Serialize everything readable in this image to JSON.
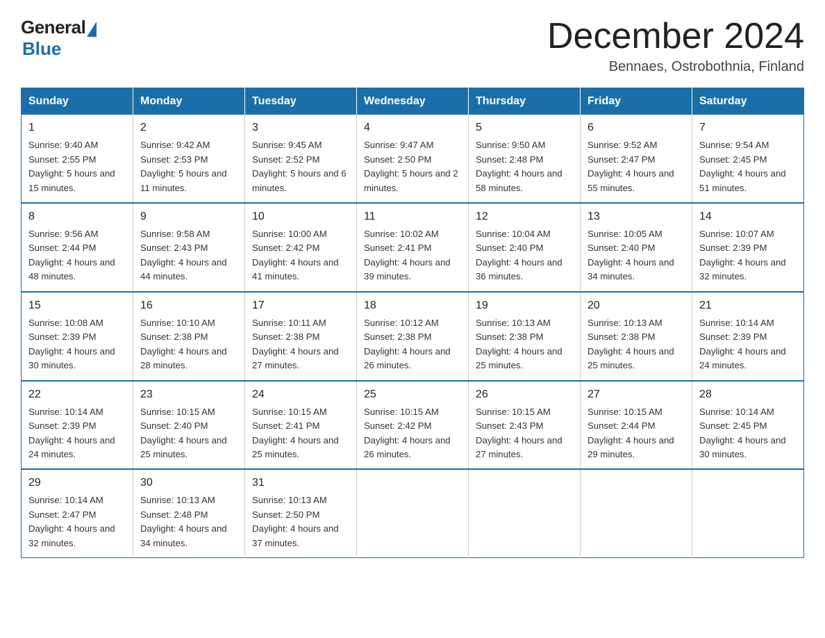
{
  "logo": {
    "general": "General",
    "blue": "Blue"
  },
  "title": "December 2024",
  "subtitle": "Bennaes, Ostrobothnia, Finland",
  "days_of_week": [
    "Sunday",
    "Monday",
    "Tuesday",
    "Wednesday",
    "Thursday",
    "Friday",
    "Saturday"
  ],
  "weeks": [
    [
      {
        "day": "1",
        "sunrise": "9:40 AM",
        "sunset": "2:55 PM",
        "daylight": "5 hours and 15 minutes."
      },
      {
        "day": "2",
        "sunrise": "9:42 AM",
        "sunset": "2:53 PM",
        "daylight": "5 hours and 11 minutes."
      },
      {
        "day": "3",
        "sunrise": "9:45 AM",
        "sunset": "2:52 PM",
        "daylight": "5 hours and 6 minutes."
      },
      {
        "day": "4",
        "sunrise": "9:47 AM",
        "sunset": "2:50 PM",
        "daylight": "5 hours and 2 minutes."
      },
      {
        "day": "5",
        "sunrise": "9:50 AM",
        "sunset": "2:48 PM",
        "daylight": "4 hours and 58 minutes."
      },
      {
        "day": "6",
        "sunrise": "9:52 AM",
        "sunset": "2:47 PM",
        "daylight": "4 hours and 55 minutes."
      },
      {
        "day": "7",
        "sunrise": "9:54 AM",
        "sunset": "2:45 PM",
        "daylight": "4 hours and 51 minutes."
      }
    ],
    [
      {
        "day": "8",
        "sunrise": "9:56 AM",
        "sunset": "2:44 PM",
        "daylight": "4 hours and 48 minutes."
      },
      {
        "day": "9",
        "sunrise": "9:58 AM",
        "sunset": "2:43 PM",
        "daylight": "4 hours and 44 minutes."
      },
      {
        "day": "10",
        "sunrise": "10:00 AM",
        "sunset": "2:42 PM",
        "daylight": "4 hours and 41 minutes."
      },
      {
        "day": "11",
        "sunrise": "10:02 AM",
        "sunset": "2:41 PM",
        "daylight": "4 hours and 39 minutes."
      },
      {
        "day": "12",
        "sunrise": "10:04 AM",
        "sunset": "2:40 PM",
        "daylight": "4 hours and 36 minutes."
      },
      {
        "day": "13",
        "sunrise": "10:05 AM",
        "sunset": "2:40 PM",
        "daylight": "4 hours and 34 minutes."
      },
      {
        "day": "14",
        "sunrise": "10:07 AM",
        "sunset": "2:39 PM",
        "daylight": "4 hours and 32 minutes."
      }
    ],
    [
      {
        "day": "15",
        "sunrise": "10:08 AM",
        "sunset": "2:39 PM",
        "daylight": "4 hours and 30 minutes."
      },
      {
        "day": "16",
        "sunrise": "10:10 AM",
        "sunset": "2:38 PM",
        "daylight": "4 hours and 28 minutes."
      },
      {
        "day": "17",
        "sunrise": "10:11 AM",
        "sunset": "2:38 PM",
        "daylight": "4 hours and 27 minutes."
      },
      {
        "day": "18",
        "sunrise": "10:12 AM",
        "sunset": "2:38 PM",
        "daylight": "4 hours and 26 minutes."
      },
      {
        "day": "19",
        "sunrise": "10:13 AM",
        "sunset": "2:38 PM",
        "daylight": "4 hours and 25 minutes."
      },
      {
        "day": "20",
        "sunrise": "10:13 AM",
        "sunset": "2:38 PM",
        "daylight": "4 hours and 25 minutes."
      },
      {
        "day": "21",
        "sunrise": "10:14 AM",
        "sunset": "2:39 PM",
        "daylight": "4 hours and 24 minutes."
      }
    ],
    [
      {
        "day": "22",
        "sunrise": "10:14 AM",
        "sunset": "2:39 PM",
        "daylight": "4 hours and 24 minutes."
      },
      {
        "day": "23",
        "sunrise": "10:15 AM",
        "sunset": "2:40 PM",
        "daylight": "4 hours and 25 minutes."
      },
      {
        "day": "24",
        "sunrise": "10:15 AM",
        "sunset": "2:41 PM",
        "daylight": "4 hours and 25 minutes."
      },
      {
        "day": "25",
        "sunrise": "10:15 AM",
        "sunset": "2:42 PM",
        "daylight": "4 hours and 26 minutes."
      },
      {
        "day": "26",
        "sunrise": "10:15 AM",
        "sunset": "2:43 PM",
        "daylight": "4 hours and 27 minutes."
      },
      {
        "day": "27",
        "sunrise": "10:15 AM",
        "sunset": "2:44 PM",
        "daylight": "4 hours and 29 minutes."
      },
      {
        "day": "28",
        "sunrise": "10:14 AM",
        "sunset": "2:45 PM",
        "daylight": "4 hours and 30 minutes."
      }
    ],
    [
      {
        "day": "29",
        "sunrise": "10:14 AM",
        "sunset": "2:47 PM",
        "daylight": "4 hours and 32 minutes."
      },
      {
        "day": "30",
        "sunrise": "10:13 AM",
        "sunset": "2:48 PM",
        "daylight": "4 hours and 34 minutes."
      },
      {
        "day": "31",
        "sunrise": "10:13 AM",
        "sunset": "2:50 PM",
        "daylight": "4 hours and 37 minutes."
      },
      null,
      null,
      null,
      null
    ]
  ],
  "sunrise_label": "Sunrise:",
  "sunset_label": "Sunset:",
  "daylight_label": "Daylight:"
}
